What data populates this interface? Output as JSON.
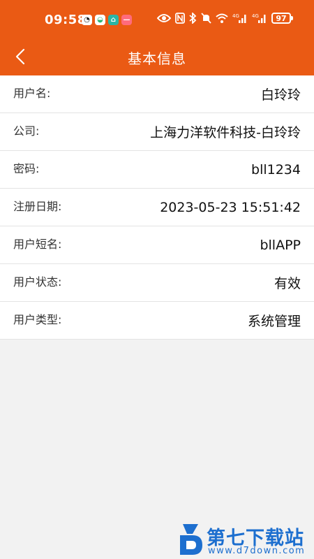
{
  "status_bar": {
    "time": "09:58",
    "notifications": [
      "qq-icon",
      "message-icon",
      "home-icon",
      "app-icon"
    ],
    "battery": "97",
    "signal_labels": [
      "4G",
      "4G"
    ]
  },
  "header": {
    "title": "基本信息",
    "back_icon": "chevron-left-icon",
    "bg_color": "#ea5a14"
  },
  "info_rows": [
    {
      "label": "用户名:",
      "value": "白玲玲"
    },
    {
      "label": "公司:",
      "value": "上海力洋软件科技-白玲玲"
    },
    {
      "label": "密码:",
      "value": "bll1234"
    },
    {
      "label": "注册日期:",
      "value": "2023-05-23 15:51:42"
    },
    {
      "label": "用户短名:",
      "value": "bllAPP"
    },
    {
      "label": "用户状态:",
      "value": "有效"
    },
    {
      "label": "用户类型:",
      "value": "系统管理"
    }
  ],
  "watermark": {
    "title": "第七下载站",
    "url": "www.d7down.com",
    "color": "#1d6fcf"
  }
}
